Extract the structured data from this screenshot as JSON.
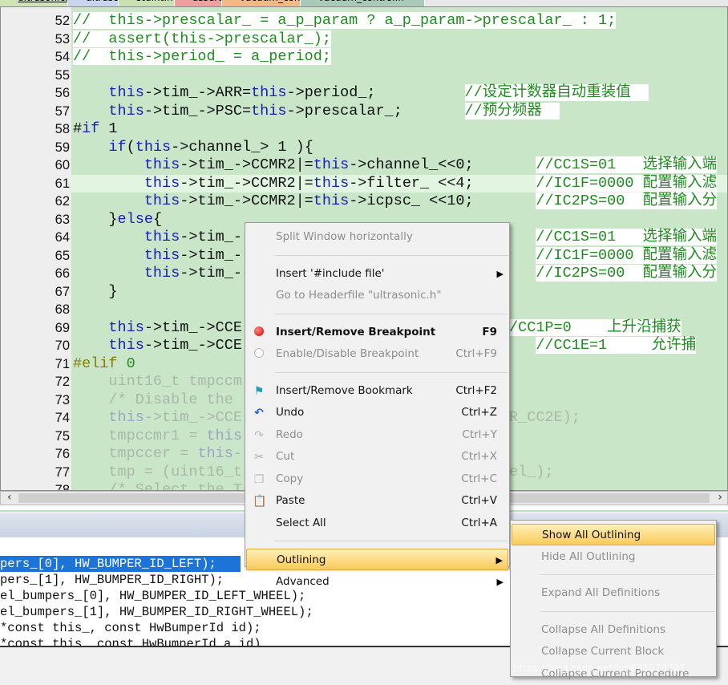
{
  "tabs": [
    {
      "label": "ultrasonic.c",
      "color": "#cfe6b4",
      "active": true
    },
    {
      "label": "ultrasonic.h",
      "color": "#c7d6ee"
    },
    {
      "label": "stdint.h",
      "color": "#c9e1b2"
    },
    {
      "label": "assert.h",
      "color": "#ef9f9f"
    },
    {
      "label": "vacuum_control.c",
      "color": "#f5b884"
    },
    {
      "label": "vacuum_control.h",
      "color": "#a9c9b9"
    }
  ],
  "editor": {
    "current_line": 61,
    "lines": [
      {
        "n": 52,
        "text": "//  this->prescalar_ = a_p_param ? a_p_param->prescalar_ : 1;"
      },
      {
        "n": 53,
        "text": "//  assert(this->prescalar_);"
      },
      {
        "n": 54,
        "text": "//  this->period_ = a_period;"
      },
      {
        "n": 55,
        "text": ""
      },
      {
        "n": 56,
        "text": "    this->tim_->ARR=this->period_;          //设定计数器自动重装值  "
      },
      {
        "n": 57,
        "text": "    this->tim_->PSC=this->prescalar_;       //预分频器  "
      },
      {
        "n": 58,
        "text": "#if 1"
      },
      {
        "n": 59,
        "text": "    if(this->channel_> 1 ){"
      },
      {
        "n": 60,
        "text": "        this->tim_->CCMR2|=this->channel_<<0;       //CC1S=01   选择输入端"
      },
      {
        "n": 61,
        "text": "        this->tim_->CCMR2|=this->filter_ <<4;       //IC1F=0000 配置输入滤"
      },
      {
        "n": 62,
        "text": "        this->tim_->CCMR2|=this->icpsc_ <<10;       //IC2PS=00  配置输入分"
      },
      {
        "n": 63,
        "text": "    }else{"
      },
      {
        "n": 64,
        "text": "        this->tim_-                                 //CC1S=01   选择输入端"
      },
      {
        "n": 65,
        "text": "        this->tim_-                                 //IC1F=0000 配置输入滤"
      },
      {
        "n": 66,
        "text": "        this->tim_-                                 //IC2PS=00  配置输入分"
      },
      {
        "n": 67,
        "text": "    }"
      },
      {
        "n": 68,
        "text": ""
      },
      {
        "n": 69,
        "text": "    this->tim_->CCE                             //CC1P=0    上升沿捕获"
      },
      {
        "n": 70,
        "text": "    this->tim_->CCE                          ;      //CC1E=1     允许捕"
      },
      {
        "n": 71,
        "text": "#elif 0"
      },
      {
        "n": 72,
        "text": "    uint16_t tmpccm",
        "dim": true
      },
      {
        "n": 73,
        "text": "    /* Disable the                          */",
        "dim": true
      },
      {
        "n": 74,
        "text": "    this->tim_->CCE                          _CCER_CC2E);",
        "dim": true
      },
      {
        "n": 75,
        "text": "    tmpccmr1 = this",
        "dim": true
      },
      {
        "n": 76,
        "text": "    tmpccer = this-",
        "dim": true
      },
      {
        "n": 77,
        "text": "    tmp = (uint16_t                            nnel_);",
        "dim": true
      },
      {
        "n": 78,
        "text": "    /* Select the T",
        "dim": true
      }
    ]
  },
  "output": {
    "lines": [
      {
        "text": "pers_[0], HW_BUMPER_ID_LEFT);",
        "selected": true
      },
      {
        "text": "pers_[1], HW_BUMPER_ID_RIGHT);"
      },
      {
        "text": "el_bumpers_[0], HW_BUMPER_ID_LEFT_WHEEL);"
      },
      {
        "text": "el_bumpers_[1], HW_BUMPER_ID_RIGHT_WHEEL);"
      },
      {
        "text": "*const this_, const HwBumperId id);"
      },
      {
        "text": "*const this_ const HwBumperId a id)"
      }
    ]
  },
  "context_menu": {
    "items": [
      {
        "label": "Split Window horizontally",
        "disabled": true
      },
      {
        "sep": true
      },
      {
        "label": "Insert '#include file'",
        "submenu": true
      },
      {
        "label": "Go to Headerfile \"ultrasonic.h\"",
        "disabled": true
      },
      {
        "sep": true
      },
      {
        "label": "Insert/Remove Breakpoint",
        "shortcut": "F9",
        "bold": true,
        "icon": "breakpoint-icon"
      },
      {
        "label": "Enable/Disable Breakpoint",
        "shortcut": "Ctrl+F9",
        "disabled": true,
        "icon": "breakpoint-outline-icon"
      },
      {
        "sep": true
      },
      {
        "label": "Insert/Remove Bookmark",
        "shortcut": "Ctrl+F2",
        "icon": "bookmark-flag-icon"
      },
      {
        "label": "Undo",
        "shortcut": "Ctrl+Z",
        "icon": "undo-icon"
      },
      {
        "label": "Redo",
        "shortcut": "Ctrl+Y",
        "disabled": true,
        "icon": "redo-icon"
      },
      {
        "label": "Cut",
        "shortcut": "Ctrl+X",
        "disabled": true,
        "icon": "scissors-icon"
      },
      {
        "label": "Copy",
        "shortcut": "Ctrl+C",
        "disabled": true,
        "icon": "copy-icon"
      },
      {
        "label": "Paste",
        "shortcut": "Ctrl+V",
        "icon": "paste-icon"
      },
      {
        "label": "Select All",
        "shortcut": "Ctrl+A"
      },
      {
        "sep": true
      },
      {
        "label": "Outlining",
        "submenu": true,
        "highlighted": true
      },
      {
        "label": "Advanced",
        "submenu": true
      }
    ]
  },
  "outlining_submenu": {
    "items": [
      {
        "label": "Show All Outlining",
        "highlighted": true
      },
      {
        "label": "Hide All Outlining",
        "disabled": true
      },
      {
        "sep": true
      },
      {
        "label": "Expand All Definitions",
        "disabled": true
      },
      {
        "sep": true
      },
      {
        "label": "Collapse All Definitions",
        "disabled": true
      },
      {
        "label": "Collapse Current Block",
        "disabled": true
      },
      {
        "label": "Collapse Current Procedure",
        "disabled": true
      }
    ]
  },
  "watermark": "https://blog.csdn.net/lyn631579741",
  "colors": {
    "editor_bg": "#c9e6c9",
    "keyword": "#1c1cb8",
    "comment": "#1e8c1e",
    "highlight": "#f9c95a",
    "selection": "#1c74d8"
  }
}
